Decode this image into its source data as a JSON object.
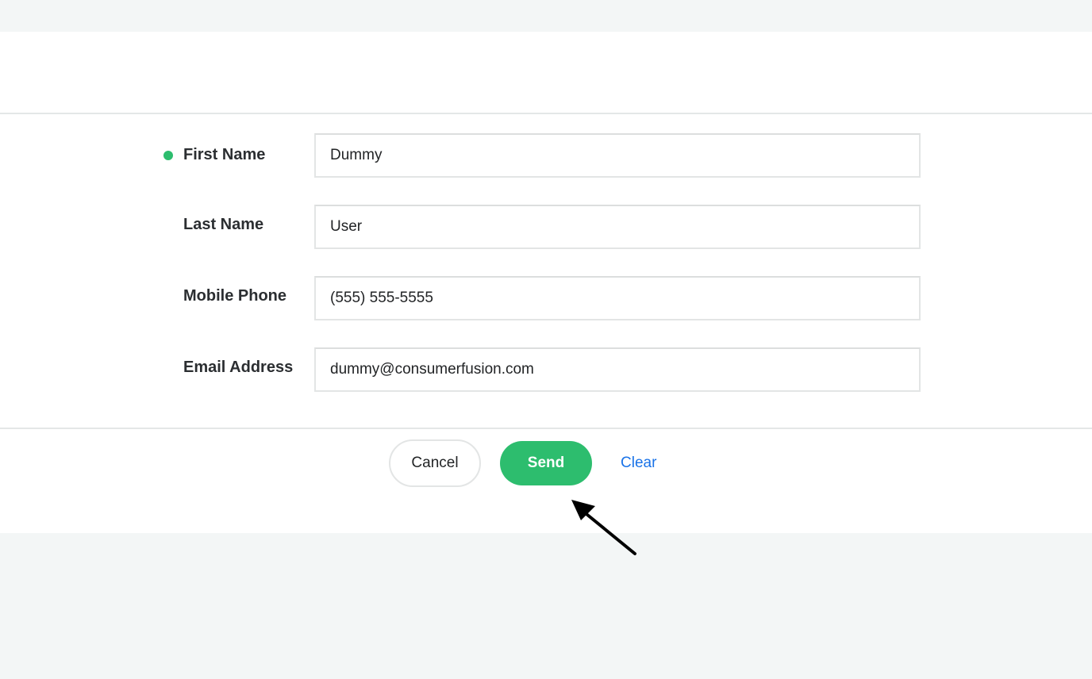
{
  "form": {
    "fields": [
      {
        "label": "First Name",
        "value": "Dummy",
        "required": true
      },
      {
        "label": "Last Name",
        "value": "User",
        "required": false
      },
      {
        "label": "Mobile Phone",
        "value": "(555) 555-5555",
        "required": false
      },
      {
        "label": "Email Address",
        "value": "dummy@consumerfusion.com",
        "required": false
      }
    ]
  },
  "actions": {
    "cancel_label": "Cancel",
    "send_label": "Send",
    "clear_label": "Clear"
  },
  "colors": {
    "accent": "#2dbd6e",
    "link": "#1a73e8",
    "background": "#f3f6f6"
  },
  "icons": {
    "required_indicator": "required-dot-icon",
    "annotation": "arrow-pointer-icon"
  }
}
